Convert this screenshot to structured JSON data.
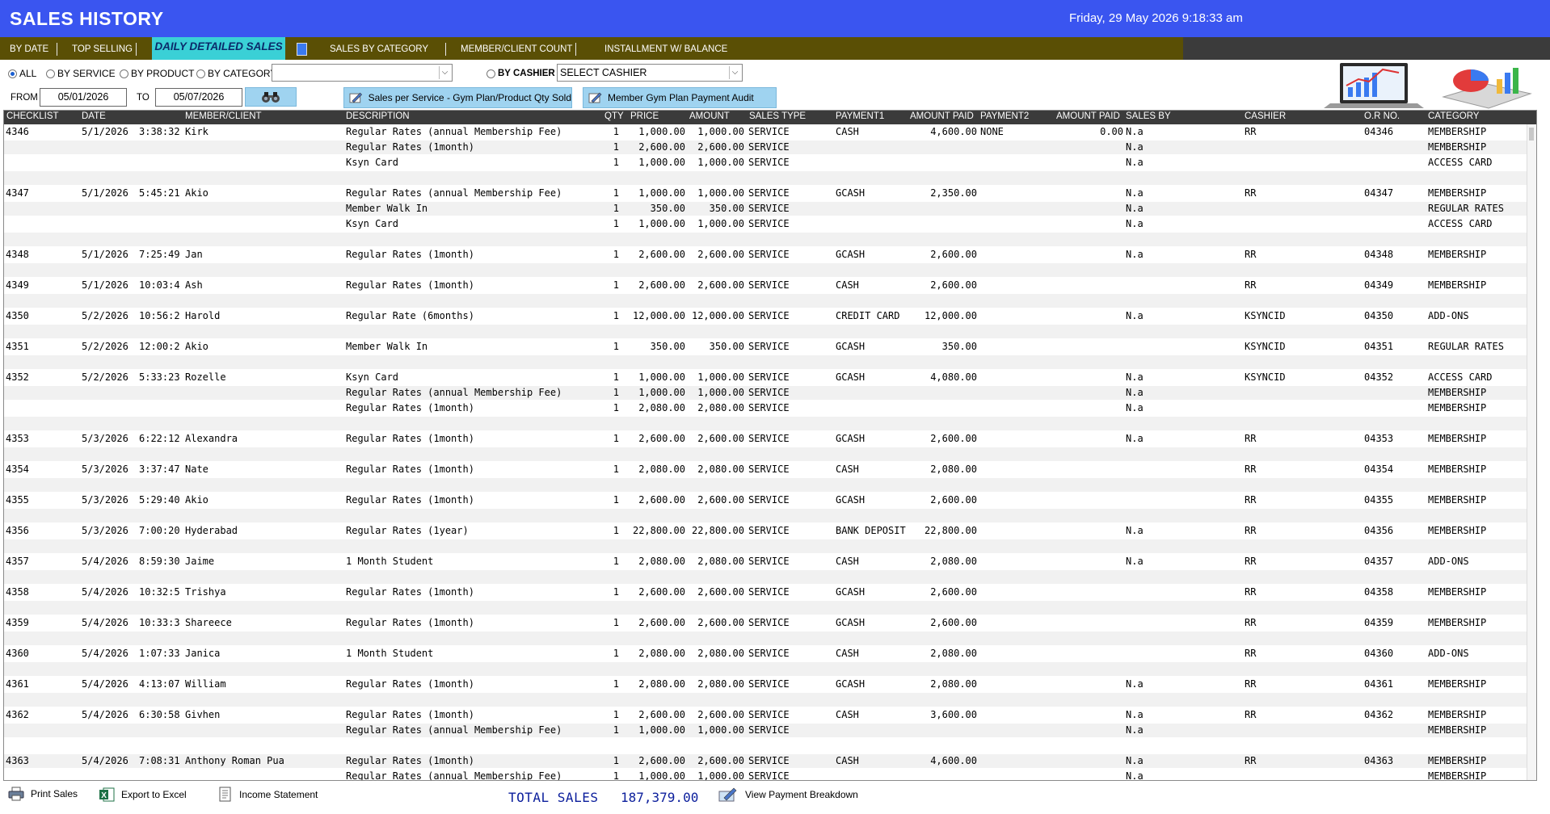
{
  "title_bar": {
    "title": "SALES HISTORY",
    "datetime": "Friday, 29 May 2026  9:18:33 am"
  },
  "tabs": [
    "BY DATE",
    "TOP SELLING",
    "DAILY DETAILED SALES",
    "SALES BY CATEGORY",
    "MEMBER/CLIENT COUNT",
    "INSTALLMENT W/ BALANCE"
  ],
  "active_tab": "DAILY DETAILED SALES",
  "filters": {
    "radios": [
      {
        "label": "ALL",
        "checked": true
      },
      {
        "label": "BY SERVICE",
        "checked": false
      },
      {
        "label": "BY PRODUCT",
        "checked": false
      },
      {
        "label": "BY CATEGORY",
        "checked": false
      },
      {
        "label": "BY CASHIER",
        "checked": false
      }
    ],
    "category_value": "",
    "cashier_value": "SELECT CASHIER",
    "from_label": "FROM",
    "from_date": "05/01/2026",
    "to_label": "TO",
    "to_date": "05/07/2026"
  },
  "action_buttons": {
    "sales_per_service": "Sales per Service - Gym Plan/Product Qty Sold",
    "gym_plan_audit": "Member Gym Plan Payment Audit"
  },
  "columns": [
    "CHECKLIST",
    "DATE",
    "MEMBER/CLIENT",
    "DESCRIPTION",
    "QTY",
    "PRICE",
    "AMOUNT",
    "SALES TYPE",
    "PAYMENT1",
    "AMOUNT PAID",
    "PAYMENT2",
    "AMOUNT PAID",
    "SALES BY",
    "CASHIER",
    "O.R NO.",
    "CATEGORY"
  ],
  "rows": [
    {
      "row": 0,
      "checklist": "4346",
      "date": "5/1/2026",
      "time": "3:38:32",
      "member": "Kirk",
      "desc": "Regular Rates (annual Membership Fee)",
      "qty": "1",
      "price": "1,000.00",
      "amount": "1,000.00",
      "type": "SERVICE",
      "pay1": "CASH",
      "paid1": "4,600.00",
      "pay2": "NONE",
      "paid2": "0.00",
      "salesby": "N.a",
      "cashier": "RR",
      "or": "04346",
      "category": "MEMBERSHIP"
    },
    {
      "row": 1,
      "desc": "Regular Rates (1month)",
      "qty": "1",
      "price": "2,600.00",
      "amount": "2,600.00",
      "type": "SERVICE",
      "salesby": "N.a",
      "category": "MEMBERSHIP"
    },
    {
      "row": 2,
      "desc": "Ksyn Card",
      "qty": "1",
      "price": "1,000.00",
      "amount": "1,000.00",
      "type": "SERVICE",
      "salesby": "N.a",
      "category": "ACCESS CARD"
    },
    {
      "row": 4,
      "checklist": "4347",
      "date": "5/1/2026",
      "time": "5:45:21",
      "member": "Akio",
      "desc": "Regular Rates (annual Membership Fee)",
      "qty": "1",
      "price": "1,000.00",
      "amount": "1,000.00",
      "type": "SERVICE",
      "pay1": "GCASH",
      "paid1": "2,350.00",
      "salesby": "N.a",
      "cashier": "RR",
      "or": "04347",
      "category": "MEMBERSHIP"
    },
    {
      "row": 5,
      "desc": "Member Walk In",
      "qty": "1",
      "price": "350.00",
      "amount": "350.00",
      "type": "SERVICE",
      "salesby": "N.a",
      "category": "REGULAR RATES"
    },
    {
      "row": 6,
      "desc": "Ksyn Card",
      "qty": "1",
      "price": "1,000.00",
      "amount": "1,000.00",
      "type": "SERVICE",
      "salesby": "N.a",
      "category": "ACCESS CARD"
    },
    {
      "row": 8,
      "checklist": "4348",
      "date": "5/1/2026",
      "time": "7:25:49",
      "member": "Jan",
      "desc": "Regular Rates (1month)",
      "qty": "1",
      "price": "2,600.00",
      "amount": "2,600.00",
      "type": "SERVICE",
      "pay1": "GCASH",
      "paid1": "2,600.00",
      "salesby": "N.a",
      "cashier": "RR",
      "or": "04348",
      "category": "MEMBERSHIP"
    },
    {
      "row": 10,
      "checklist": "4349",
      "date": "5/1/2026",
      "time": "10:03:4(",
      "member": "Ash",
      "desc": "Regular Rates (1month)",
      "qty": "1",
      "price": "2,600.00",
      "amount": "2,600.00",
      "type": "SERVICE",
      "pay1": "CASH",
      "paid1": "2,600.00",
      "cashier": "RR",
      "or": "04349",
      "category": "MEMBERSHIP"
    },
    {
      "row": 12,
      "checklist": "4350",
      "date": "5/2/2026",
      "time": "10:56:2:",
      "member": "Harold",
      "desc": "Regular Rate (6months)",
      "qty": "1",
      "price": "12,000.00",
      "amount": "12,000.00",
      "type": "SERVICE",
      "pay1": "CREDIT CARD",
      "paid1": "12,000.00",
      "salesby": "N.a",
      "cashier": "KSYNCID",
      "or": "04350",
      "category": "ADD-ONS"
    },
    {
      "row": 14,
      "checklist": "4351",
      "date": "5/2/2026",
      "time": "12:00:2!",
      "member": "Akio",
      "desc": "Member Walk In",
      "qty": "1",
      "price": "350.00",
      "amount": "350.00",
      "type": "SERVICE",
      "pay1": "GCASH",
      "paid1": "350.00",
      "cashier": "KSYNCID",
      "or": "04351",
      "category": "REGULAR RATES"
    },
    {
      "row": 16,
      "checklist": "4352",
      "date": "5/2/2026",
      "time": "5:33:23",
      "member": "Rozelle",
      "desc": "Ksyn Card",
      "qty": "1",
      "price": "1,000.00",
      "amount": "1,000.00",
      "type": "SERVICE",
      "pay1": "GCASH",
      "paid1": "4,080.00",
      "salesby": "N.a",
      "cashier": "KSYNCID",
      "or": "04352",
      "category": "ACCESS CARD"
    },
    {
      "row": 17,
      "desc": "Regular Rates (annual Membership Fee)",
      "qty": "1",
      "price": "1,000.00",
      "amount": "1,000.00",
      "type": "SERVICE",
      "salesby": "N.a",
      "category": "MEMBERSHIP"
    },
    {
      "row": 18,
      "desc": "Regular Rates (1month)",
      "qty": "1",
      "price": "2,080.00",
      "amount": "2,080.00",
      "type": "SERVICE",
      "salesby": "N.a",
      "category": "MEMBERSHIP"
    },
    {
      "row": 20,
      "checklist": "4353",
      "date": "5/3/2026",
      "time": "6:22:12",
      "member": "Alexandra",
      "desc": "Regular Rates (1month)",
      "qty": "1",
      "price": "2,600.00",
      "amount": "2,600.00",
      "type": "SERVICE",
      "pay1": "GCASH",
      "paid1": "2,600.00",
      "salesby": "N.a",
      "cashier": "RR",
      "or": "04353",
      "category": "MEMBERSHIP"
    },
    {
      "row": 22,
      "checklist": "4354",
      "date": "5/3/2026",
      "time": "3:37:47",
      "member": "Nate",
      "desc": "Regular Rates (1month)",
      "qty": "1",
      "price": "2,080.00",
      "amount": "2,080.00",
      "type": "SERVICE",
      "pay1": "CASH",
      "paid1": "2,080.00",
      "cashier": "RR",
      "or": "04354",
      "category": "MEMBERSHIP"
    },
    {
      "row": 24,
      "checklist": "4355",
      "date": "5/3/2026",
      "time": "5:29:40",
      "member": "Akio",
      "desc": "Regular Rates (1month)",
      "qty": "1",
      "price": "2,600.00",
      "amount": "2,600.00",
      "type": "SERVICE",
      "pay1": "GCASH",
      "paid1": "2,600.00",
      "cashier": "RR",
      "or": "04355",
      "category": "MEMBERSHIP"
    },
    {
      "row": 26,
      "checklist": "4356",
      "date": "5/3/2026",
      "time": "7:00:20",
      "member": "Hyderabad",
      "desc": "Regular Rates (1year)",
      "qty": "1",
      "price": "22,800.00",
      "amount": "22,800.00",
      "type": "SERVICE",
      "pay1": "BANK DEPOSIT",
      "paid1": "22,800.00",
      "salesby": "N.a",
      "cashier": "RR",
      "or": "04356",
      "category": "MEMBERSHIP"
    },
    {
      "row": 28,
      "checklist": "4357",
      "date": "5/4/2026",
      "time": "8:59:30",
      "member": "Jaime",
      "desc": "1 Month Student",
      "qty": "1",
      "price": "2,080.00",
      "amount": "2,080.00",
      "type": "SERVICE",
      "pay1": "CASH",
      "paid1": "2,080.00",
      "salesby": "N.a",
      "cashier": "RR",
      "or": "04357",
      "category": "ADD-ONS"
    },
    {
      "row": 30,
      "checklist": "4358",
      "date": "5/4/2026",
      "time": "10:32:5'",
      "member": "Trishya",
      "desc": "Regular Rates (1month)",
      "qty": "1",
      "price": "2,600.00",
      "amount": "2,600.00",
      "type": "SERVICE",
      "pay1": "GCASH",
      "paid1": "2,600.00",
      "cashier": "RR",
      "or": "04358",
      "category": "MEMBERSHIP"
    },
    {
      "row": 32,
      "checklist": "4359",
      "date": "5/4/2026",
      "time": "10:33:3(",
      "member": "Shareece",
      "desc": "Regular Rates (1month)",
      "qty": "1",
      "price": "2,600.00",
      "amount": "2,600.00",
      "type": "SERVICE",
      "pay1": "GCASH",
      "paid1": "2,600.00",
      "cashier": "RR",
      "or": "04359",
      "category": "MEMBERSHIP"
    },
    {
      "row": 34,
      "checklist": "4360",
      "date": "5/4/2026",
      "time": "1:07:33",
      "member": "Janica",
      "desc": "1 Month Student",
      "qty": "1",
      "price": "2,080.00",
      "amount": "2,080.00",
      "type": "SERVICE",
      "pay1": "CASH",
      "paid1": "2,080.00",
      "cashier": "RR",
      "or": "04360",
      "category": "ADD-ONS"
    },
    {
      "row": 36,
      "checklist": "4361",
      "date": "5/4/2026",
      "time": "4:13:07",
      "member": "William",
      "desc": "Regular Rates (1month)",
      "qty": "1",
      "price": "2,080.00",
      "amount": "2,080.00",
      "type": "SERVICE",
      "pay1": "GCASH",
      "paid1": "2,080.00",
      "salesby": "N.a",
      "cashier": "RR",
      "or": "04361",
      "category": "MEMBERSHIP"
    },
    {
      "row": 38,
      "checklist": "4362",
      "date": "5/4/2026",
      "time": "6:30:58",
      "member": "Givhen",
      "desc": "Regular Rates (1month)",
      "qty": "1",
      "price": "2,600.00",
      "amount": "2,600.00",
      "type": "SERVICE",
      "pay1": "CASH",
      "paid1": "3,600.00",
      "salesby": "N.a",
      "cashier": "RR",
      "or": "04362",
      "category": "MEMBERSHIP"
    },
    {
      "row": 39,
      "desc": "Regular Rates (annual Membership Fee)",
      "qty": "1",
      "price": "1,000.00",
      "amount": "1,000.00",
      "type": "SERVICE",
      "salesby": "N.a",
      "category": "MEMBERSHIP"
    },
    {
      "row": 41,
      "checklist": "4363",
      "date": "5/4/2026",
      "time": "7:08:31",
      "member": "Anthony Roman Pua",
      "desc": "Regular Rates (1month)",
      "qty": "1",
      "price": "2,600.00",
      "amount": "2,600.00",
      "type": "SERVICE",
      "pay1": "CASH",
      "paid1": "4,600.00",
      "salesby": "N.a",
      "cashier": "RR",
      "or": "04363",
      "category": "MEMBERSHIP"
    },
    {
      "row": 42,
      "desc": "Regular Rates (annual Membership Fee)",
      "qty": "1",
      "price": "1,000.00",
      "amount": "1,000.00",
      "type": "SERVICE",
      "salesby": "N.a",
      "category": "MEMBERSHIP"
    }
  ],
  "footer": {
    "print": "Print Sales",
    "export": "Export to Excel",
    "income": "Income Statement",
    "total_label": "TOTAL SALES",
    "total_value": "187,379.00",
    "breakdown": "View Payment Breakdown"
  },
  "icons": [
    "binoculars-icon",
    "pencil-icon",
    "printer-icon",
    "excel-icon",
    "document-icon",
    "pencil-icon",
    "laptop-chart-icon",
    "pie-chart-icon"
  ],
  "colors": {
    "title_bar": "#3a55f0",
    "tab_bar": "#5a4f05",
    "active_tab": "#3ad0d6",
    "button": "#9fd3f0",
    "grid_header": "#3b3b3b",
    "total_text": "#0b1e9c"
  }
}
